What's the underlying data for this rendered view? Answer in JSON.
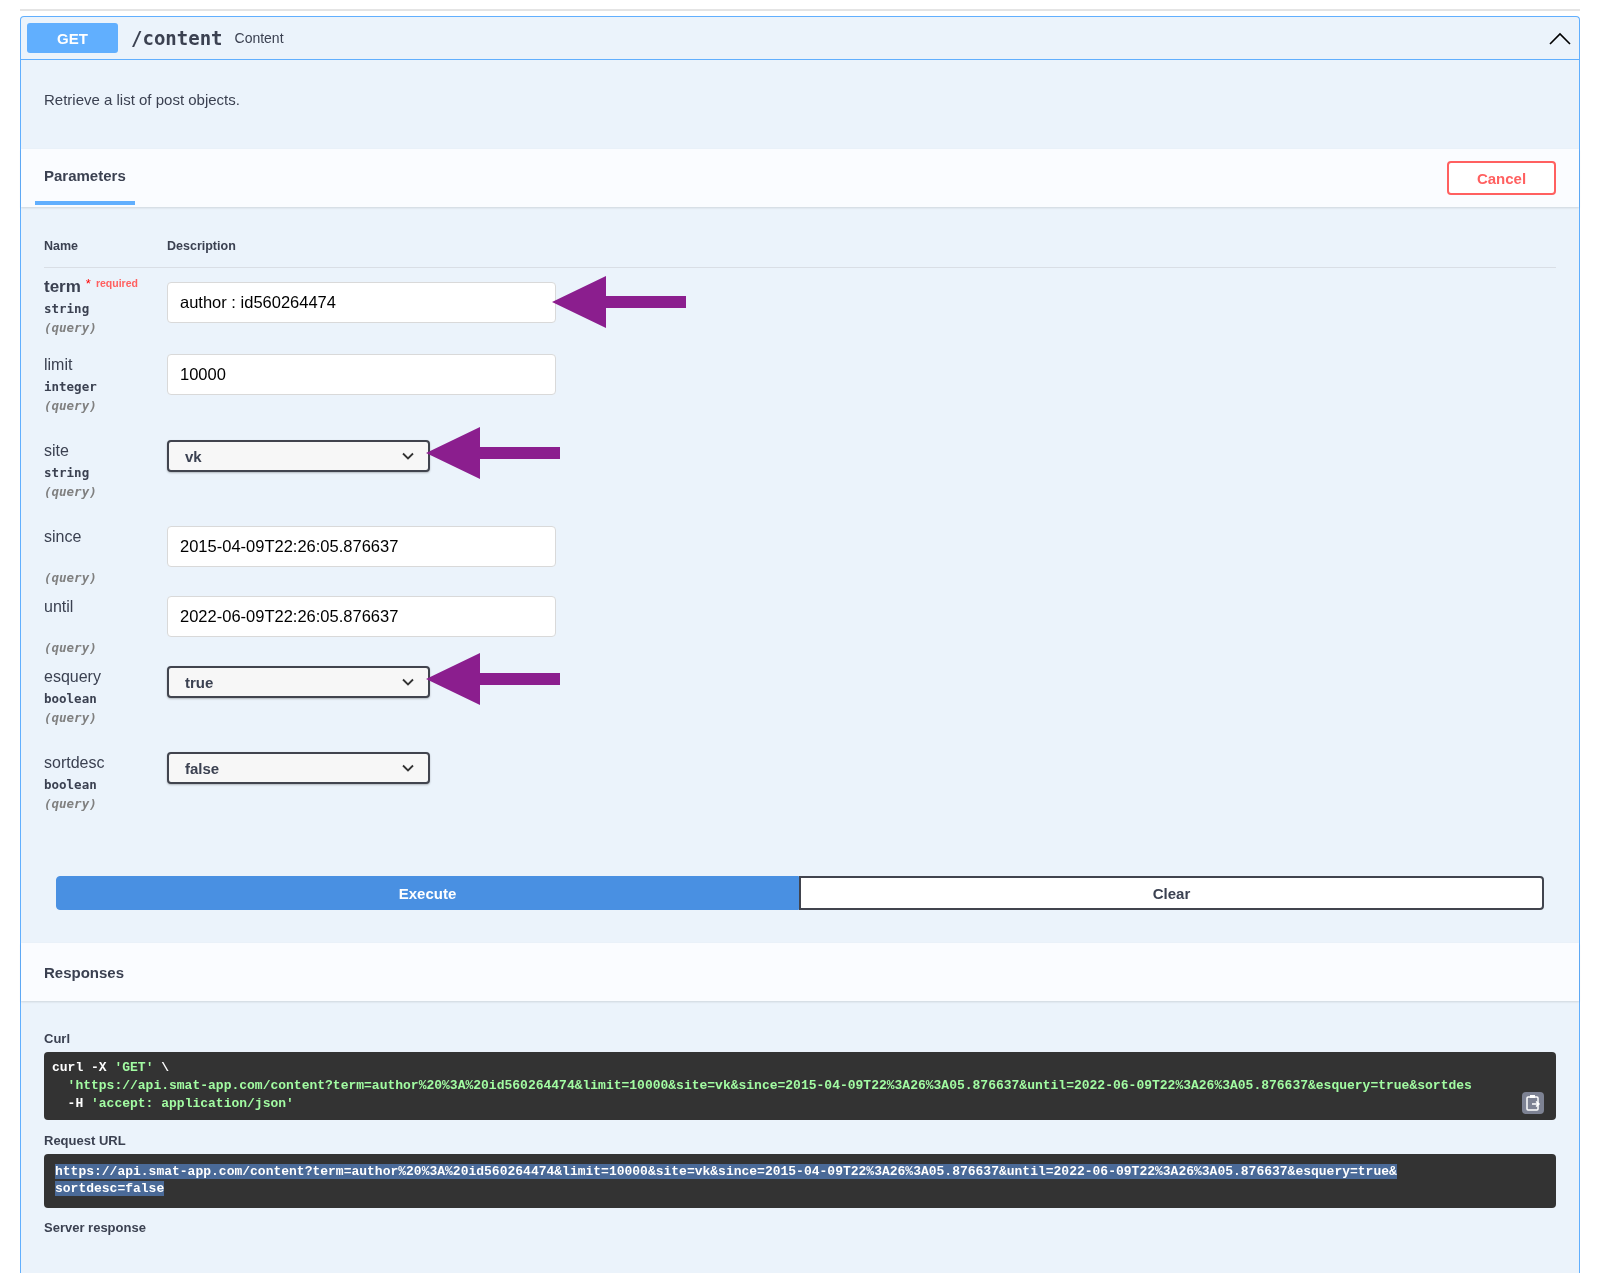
{
  "operation": {
    "method": "GET",
    "path": "/content",
    "summary": "Content",
    "expanded": true
  },
  "description": "Retrieve a list of post objects.",
  "parameters_tab": {
    "label": "Parameters",
    "selected": true
  },
  "cancel_button": "Cancel",
  "table": {
    "columns": [
      "Name",
      "Description"
    ]
  },
  "parameters": [
    {
      "name": "term",
      "required_mark": "*",
      "required_label": "required",
      "type": "string",
      "in": "(query)",
      "kind": "input",
      "value": "author : id560264474",
      "annotated": true
    },
    {
      "name": "limit",
      "type": "integer",
      "in": "(query)",
      "kind": "input",
      "value": "10000",
      "annotated": false
    },
    {
      "name": "site",
      "type": "string",
      "in": "(query)",
      "kind": "select",
      "value": "vk",
      "annotated": true
    },
    {
      "name": "since",
      "in": "(query)",
      "kind": "input",
      "value": "2015-04-09T22:26:05.876637",
      "annotated": false
    },
    {
      "name": "until",
      "in": "(query)",
      "kind": "input",
      "value": "2022-06-09T22:26:05.876637",
      "annotated": false
    },
    {
      "name": "esquery",
      "type": "boolean",
      "in": "(query)",
      "kind": "select",
      "value": "true",
      "annotated": true
    },
    {
      "name": "sortdesc",
      "type": "boolean",
      "in": "(query)",
      "kind": "select",
      "value": "false",
      "annotated": false
    }
  ],
  "execute_button": "Execute",
  "clear_button": "Clear",
  "responses": {
    "title": "Responses",
    "curl_label": "Curl",
    "curl": {
      "command": "curl -X ",
      "method": "'GET'",
      "continuation": " \\",
      "url": "  'https://api.smat-app.com/content?term=author%20%3A%20id560264474&limit=10000&site=vk&since=2015-04-09T22%3A26%3A05.876637&until=2022-06-09T22%3A26%3A05.876637&esquery=true&sortdes",
      "header_flag": "  -H ",
      "header": "'accept: application/json'"
    },
    "request_url_label": "Request URL",
    "request_url_lines": [
      "https://api.smat-app.com/content?term=author%20%3A%20id560264474&limit=10000&site=vk&since=2015-04-09T22%3A26%3A05.876637&until=2022-06-09T22%3A26%3A05.876637&esquery=true&",
      "sortdesc=false"
    ],
    "server_response_label": "Server response"
  }
}
